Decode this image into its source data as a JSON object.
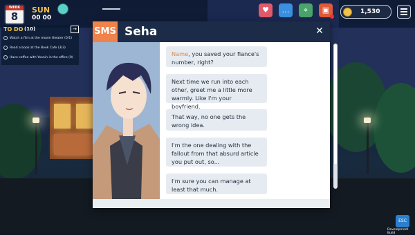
{
  "hud": {
    "week_label": "WEEK",
    "week_number": "8",
    "day": "SUN",
    "time": "00 00",
    "money": "1,530"
  },
  "todo": {
    "title": "TO DO",
    "count": "(10)",
    "arrow": "→",
    "items": [
      "Watch a film at the movie theater (0/1)",
      "Read a book at the Book Cafe (3/3)",
      "Have coffee with Yoonin in the office (0/"
    ]
  },
  "icons": {
    "top_bar": [
      "heart-card-icon",
      "chat-bubble-icon",
      "map-icon",
      "gift-icon"
    ],
    "money": "coin-icon",
    "menu": "hamburger-menu-icon"
  },
  "colors": {
    "sms_badge": "#f0834b",
    "header": "#1c2c48",
    "name_highlight": "#d78a52",
    "gold": "#f3c34a"
  },
  "sms": {
    "badge": "SMS",
    "contact": "Seha",
    "close": "✕",
    "messages": [
      {
        "name": "Name",
        "text": ", you saved your fiance's number, right?"
      },
      {
        "name": "",
        "text": "Next time we run into each other, greet me a little more warmly. Like I'm your boyfriend."
      },
      {
        "name": "",
        "text": "That way, no one gets the wrong idea."
      },
      {
        "name": "",
        "text": "I'm the one dealing with the fallout from that absurd article you put out, so..."
      },
      {
        "name": "",
        "text": "I'm sure you can manage at least that much."
      }
    ]
  },
  "footer": {
    "esc": "ESC",
    "dev_build": "Development Build"
  }
}
